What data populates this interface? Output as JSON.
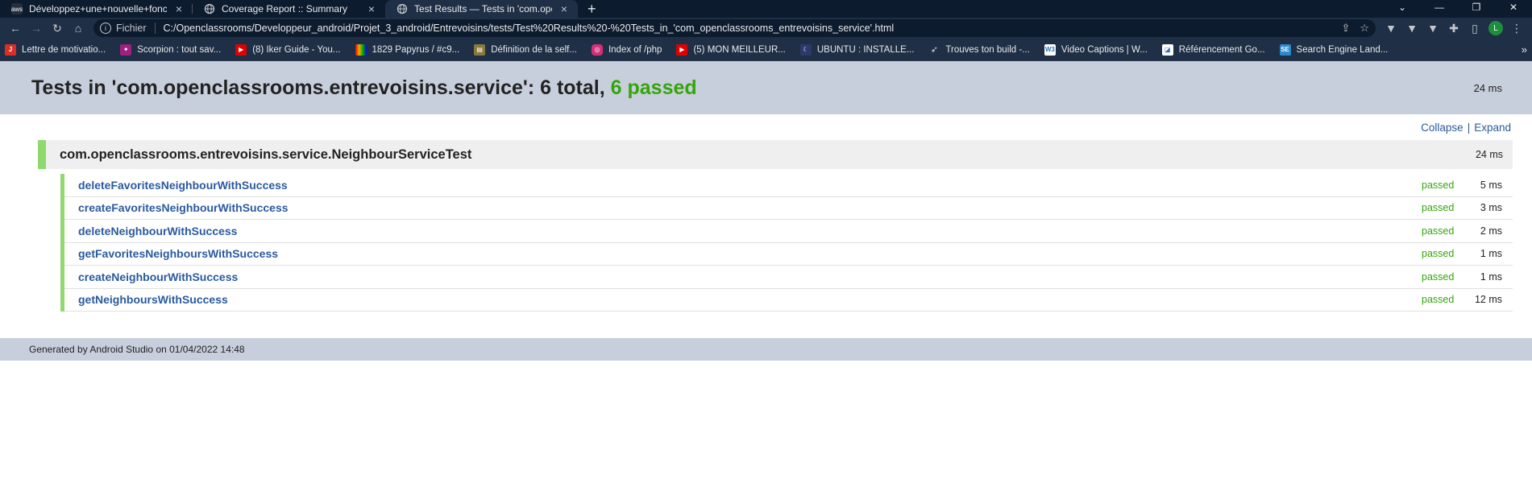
{
  "browser": {
    "tabs": [
      {
        "title": "Développez+une+nouvelle+fonc",
        "icon": "aws-icon",
        "active": false
      },
      {
        "title": "Coverage Report :: Summary",
        "icon": "globe-icon",
        "active": false
      },
      {
        "title": "Test Results — Tests in 'com.oper",
        "icon": "globe-icon",
        "active": true
      }
    ],
    "new_tab": "+",
    "url_scheme_label": "Fichier",
    "url": "C:/Openclassrooms/Developpeur_android/Projet_3_android/Entrevoisins/tests/Test%20Results%20-%20Tests_in_'com_openclassrooms_entrevoisins_service'.html",
    "avatar_letter": "L",
    "bookmarks": [
      {
        "label": "Lettre de motivatio...",
        "icon": "j-icon",
        "color": "#d93025"
      },
      {
        "label": "Scorpion : tout sav...",
        "icon": "scorpion-icon",
        "color": "#a02080"
      },
      {
        "label": "(8) Iker Guide - You...",
        "icon": "youtube-icon",
        "color": "#e00000"
      },
      {
        "label": "1829 Papyrus / #c9...",
        "icon": "papyrus-icon",
        "color": "#e8b000"
      },
      {
        "label": "Définition de la self...",
        "icon": "book-icon",
        "color": "#8a7a3a"
      },
      {
        "label": "Index of /php",
        "icon": "instagram-icon",
        "color": "#d4307a"
      },
      {
        "label": "(5) MON MEILLEUR...",
        "icon": "youtube-icon",
        "color": "#e00000"
      },
      {
        "label": "UBUNTU : INSTALLE...",
        "icon": "moon-icon",
        "color": "#2b3a6a"
      },
      {
        "label": "Trouves ton build -...",
        "icon": "bird-icon",
        "color": "#cccccc"
      },
      {
        "label": "Video Captions | W...",
        "icon": "w3-icon",
        "color": "#2a7ab0"
      },
      {
        "label": "Référencement Go...",
        "icon": "site-icon",
        "color": "#3a6ab0"
      },
      {
        "label": "Search Engine Land...",
        "icon": "sel-icon",
        "color": "#2a8ad0"
      }
    ]
  },
  "page": {
    "title_prefix": "Tests in 'com.openclassrooms.entrevoisins.service': 6 total, ",
    "title_passed": "6 passed",
    "total_duration": "24 ms",
    "collapse_label": "Collapse",
    "expand_label": "Expand",
    "separator": "|",
    "class_name": "com.openclassrooms.entrevoisins.service.NeighbourServiceTest",
    "class_duration": "24 ms",
    "tests": [
      {
        "name": "deleteFavoritesNeighbourWithSuccess",
        "status": "passed",
        "duration": "5 ms"
      },
      {
        "name": "createFavoritesNeighbourWithSuccess",
        "status": "passed",
        "duration": "3 ms"
      },
      {
        "name": "deleteNeighbourWithSuccess",
        "status": "passed",
        "duration": "2 ms"
      },
      {
        "name": "getFavoritesNeighboursWithSuccess",
        "status": "passed",
        "duration": "1 ms"
      },
      {
        "name": "createNeighbourWithSuccess",
        "status": "passed",
        "duration": "1 ms"
      },
      {
        "name": "getNeighboursWithSuccess",
        "status": "passed",
        "duration": "12 ms"
      }
    ],
    "footer": "Generated by Android Studio on 01/04/2022 14:48"
  },
  "colors": {
    "pass_green": "#34a50b",
    "link_blue": "#2a5aa0",
    "header_bg": "#c8cfdc",
    "bar_green": "#8fd96f"
  }
}
